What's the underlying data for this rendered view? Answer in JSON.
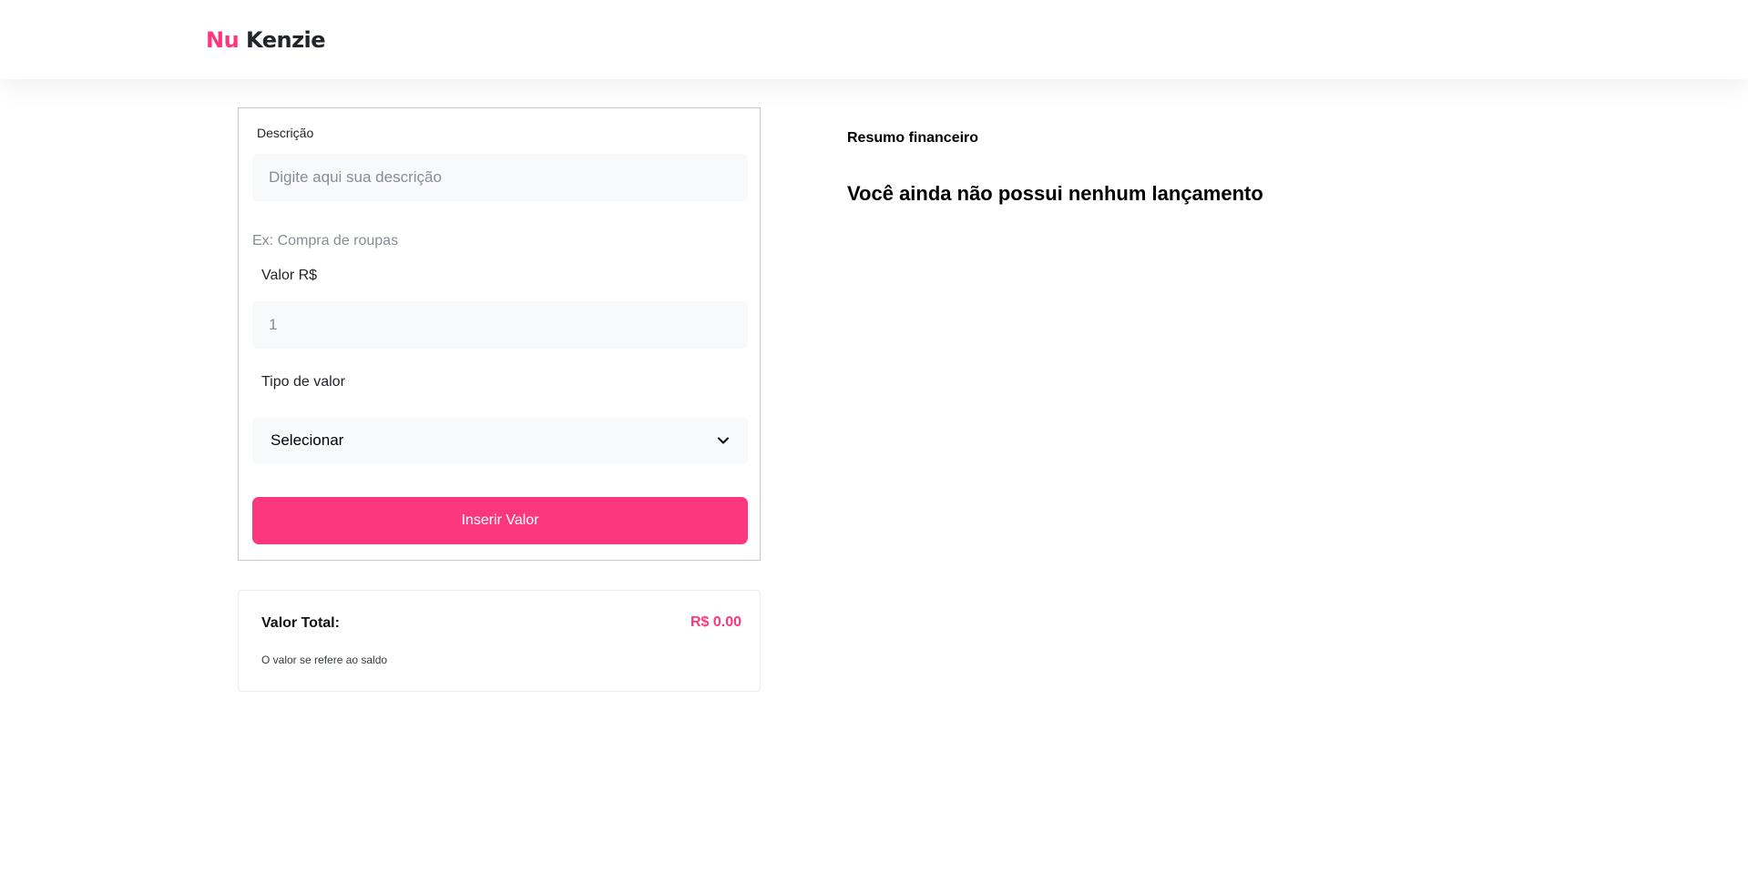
{
  "header": {
    "logo_part1": "Nu",
    "logo_part2": "Kenzie",
    "brand_color": "#fd377e"
  },
  "form": {
    "description_label": "Descrição",
    "description_placeholder": "Digite aqui sua descrição",
    "description_hint": "Ex: Compra de roupas",
    "value_label": "Valor R$",
    "value_input": "1",
    "type_label": "Tipo de valor",
    "type_selected": "Selecionar",
    "submit_label": "Inserir Valor"
  },
  "total": {
    "title": "Valor Total:",
    "value": "R$ 0.00",
    "note": "O valor se refere ao saldo"
  },
  "summary": {
    "title": "Resumo financeiro",
    "empty_message": "Você ainda não possui nenhum lançamento"
  },
  "icons": {
    "select_arrow": "chevron-down-icon"
  }
}
